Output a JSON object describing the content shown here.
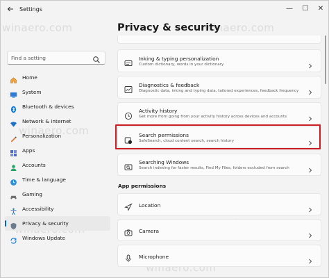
{
  "window": {
    "title": "Settings",
    "minimize": "—",
    "maximize": "☐",
    "close": "✕"
  },
  "sidebar": {
    "search_placeholder": "Find a setting",
    "items": [
      {
        "label": "Home",
        "icon": "home-icon"
      },
      {
        "label": "System",
        "icon": "system-icon"
      },
      {
        "label": "Bluetooth & devices",
        "icon": "bluetooth-icon"
      },
      {
        "label": "Network & internet",
        "icon": "network-icon"
      },
      {
        "label": "Personalization",
        "icon": "personalization-icon"
      },
      {
        "label": "Apps",
        "icon": "apps-icon"
      },
      {
        "label": "Accounts",
        "icon": "accounts-icon"
      },
      {
        "label": "Time & language",
        "icon": "time-language-icon"
      },
      {
        "label": "Gaming",
        "icon": "gaming-icon"
      },
      {
        "label": "Accessibility",
        "icon": "accessibility-icon"
      },
      {
        "label": "Privacy & security",
        "icon": "shield-icon",
        "selected": true
      },
      {
        "label": "Windows Update",
        "icon": "windows-update-icon"
      }
    ]
  },
  "main": {
    "title": "Privacy & security",
    "cards": [
      {
        "title": "Inking & typing personalization",
        "subtitle": "Custom dictionary, words in your dictionary",
        "icon": "inking-icon"
      },
      {
        "title": "Diagnostics & feedback",
        "subtitle": "Diagnostic data, inking and typing data, tailored experiences, feedback frequency",
        "icon": "diagnostics-icon"
      },
      {
        "title": "Activity history",
        "subtitle": "Get more from going from your activity history across devices and accounts",
        "icon": "activity-history-icon"
      },
      {
        "title": "Search permissions",
        "subtitle": "SafeSearch, cloud content search, search history",
        "icon": "search-permissions-icon",
        "highlighted": true
      },
      {
        "title": "Searching Windows",
        "subtitle": "Search indexing for faster results, Find My Files, folders excluded from search",
        "icon": "searching-windows-icon"
      }
    ],
    "app_permissions_label": "App permissions",
    "app_permissions": [
      {
        "title": "Location",
        "icon": "location-icon"
      },
      {
        "title": "Camera",
        "icon": "camera-icon"
      },
      {
        "title": "Microphone",
        "icon": "microphone-icon"
      }
    ]
  },
  "watermark": "winaero.com",
  "colors": {
    "accent": "#0067c0",
    "highlight_border": "#cc1c23",
    "background": "#f3f3f3",
    "card": "#fbfbfb"
  }
}
